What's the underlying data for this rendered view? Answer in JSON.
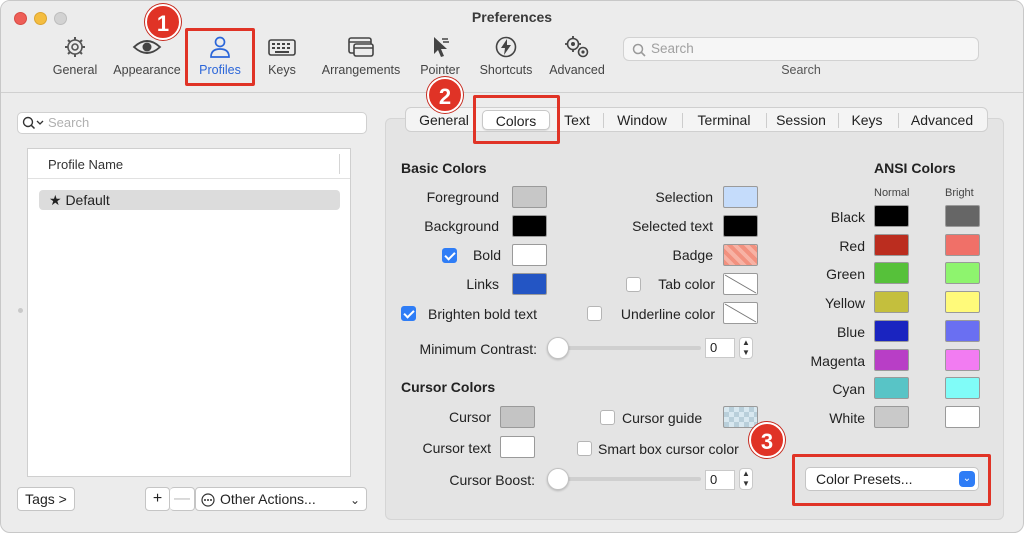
{
  "window": {
    "title": "Preferences"
  },
  "toolbar": {
    "items": [
      {
        "label": "General",
        "icon": "gear-icon"
      },
      {
        "label": "Appearance",
        "icon": "eye-icon"
      },
      {
        "label": "Profiles",
        "icon": "person-icon"
      },
      {
        "label": "Keys",
        "icon": "keyboard-icon"
      },
      {
        "label": "Arrangements",
        "icon": "windows-icon"
      },
      {
        "label": "Pointer",
        "icon": "pointer-icon"
      },
      {
        "label": "Shortcuts",
        "icon": "lightning-icon"
      },
      {
        "label": "Advanced",
        "icon": "gears-icon"
      }
    ],
    "search_placeholder": "Search",
    "search_label": "Search"
  },
  "annotations": {
    "b1": "1",
    "b2": "2",
    "b3": "3",
    "accent": "#e03326"
  },
  "left": {
    "search_placeholder": "Search",
    "column_header": "Profile Name",
    "profiles": [
      "★ Default"
    ],
    "tags_button": "Tags >",
    "add": "+",
    "remove": "—",
    "other_actions": "Other Actions..."
  },
  "tabs": [
    "General",
    "Colors",
    "Text",
    "Window",
    "Terminal",
    "Session",
    "Keys",
    "Advanced"
  ],
  "basic": {
    "title": "Basic Colors",
    "foreground": "Foreground",
    "background": "Background",
    "bold": "Bold",
    "links": "Links",
    "brighten": "Brighten bold text",
    "selection": "Selection",
    "selected_text": "Selected text",
    "badge": "Badge",
    "tab_color": "Tab color",
    "underline_color": "Underline color",
    "min_contrast": "Minimum Contrast:",
    "min_contrast_value": "0"
  },
  "cursor": {
    "title": "Cursor Colors",
    "cursor": "Cursor",
    "cursor_text": "Cursor text",
    "cursor_guide": "Cursor guide",
    "smart_box": "Smart box cursor color",
    "boost": "Cursor Boost:",
    "boost_value": "0"
  },
  "ansi": {
    "title": "ANSI Colors",
    "normal": "Normal",
    "bright": "Bright",
    "rows": [
      {
        "name": "Black",
        "normal": "#000000",
        "bright": "#666666"
      },
      {
        "name": "Red",
        "normal": "#bb2d1f",
        "bright": "#f07068"
      },
      {
        "name": "Green",
        "normal": "#56c13a",
        "bright": "#8ef46e"
      },
      {
        "name": "Yellow",
        "normal": "#c4bf3d",
        "bright": "#fffa7a"
      },
      {
        "name": "Blue",
        "normal": "#1a24c0",
        "bright": "#6a6ff2"
      },
      {
        "name": "Magenta",
        "normal": "#b83ec6",
        "bright": "#f27cf2"
      },
      {
        "name": "Cyan",
        "normal": "#58c4c6",
        "bright": "#80fcf8"
      },
      {
        "name": "White",
        "normal": "#c9c9c9",
        "bright": "#ffffff"
      }
    ]
  },
  "presets": {
    "label": "Color Presets..."
  }
}
